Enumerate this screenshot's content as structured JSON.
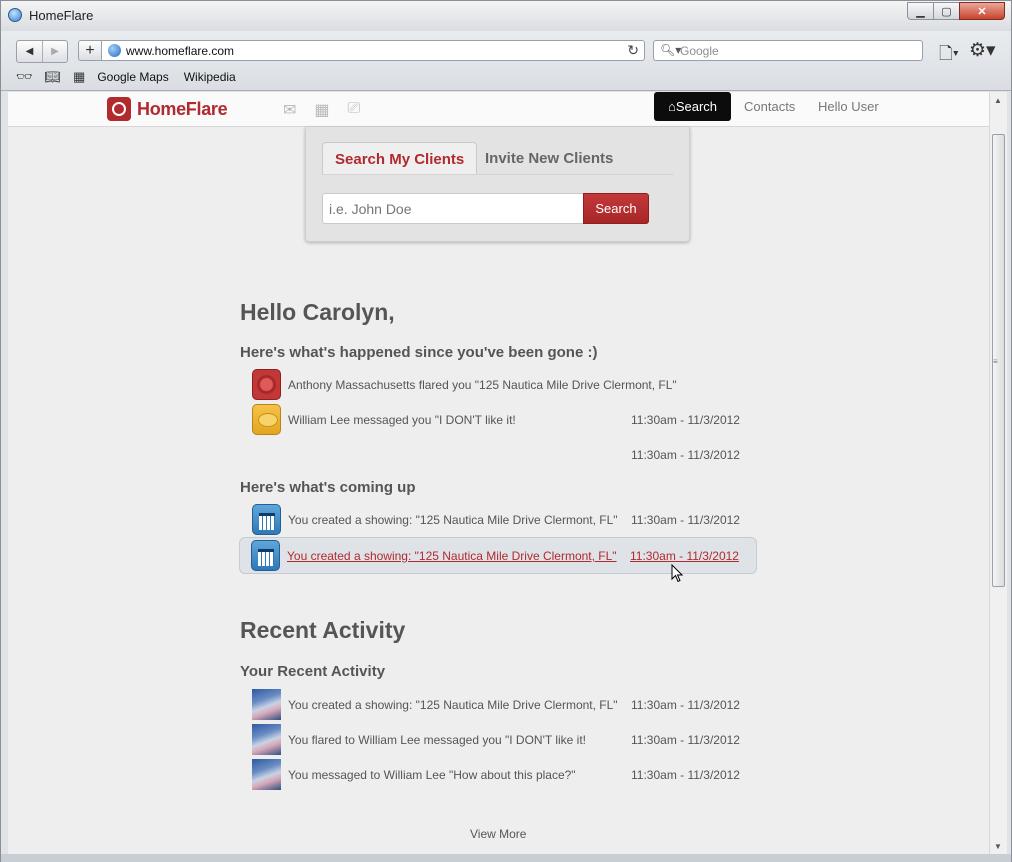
{
  "window": {
    "title": "HomeFlare"
  },
  "browser": {
    "url": "www.homeflare.com",
    "search_placeholder": "Google",
    "bookmarks": [
      "Google Maps",
      "Wikipedia"
    ]
  },
  "site": {
    "logo": "HomeFlare",
    "nav": {
      "search": "Search",
      "contacts": "Contacts",
      "user": "Hello User"
    }
  },
  "search_panel": {
    "tabs": [
      "Search My Clients",
      "Invite New Clients"
    ],
    "placeholder": "i.e. John Doe",
    "button": "Search"
  },
  "greeting": "Hello Carolyn,",
  "since_gone": {
    "heading": "Here's what's happened since you've been gone :)",
    "items": [
      {
        "icon": "flare-icon",
        "text": "Anthony Massachusetts flared you \"125 Nautica Mile Drive Clermont, FL\"",
        "time": ""
      },
      {
        "icon": "message-icon",
        "text": "William Lee messaged you \"I DON'T like it!",
        "time": "11:30am - 11/3/2012"
      },
      {
        "icon": "",
        "text": "",
        "time": "11:30am - 11/3/2012"
      }
    ]
  },
  "coming_up": {
    "heading": "Here's what's coming up",
    "items": [
      {
        "icon": "calendar-icon",
        "text": "You created a showing: \"125 Nautica Mile Drive Clermont, FL\"",
        "time": "11:30am - 11/3/2012"
      },
      {
        "icon": "calendar-icon",
        "text": "You created a showing: \"125 Nautica Mile Drive Clermont, FL\"",
        "time": "11:30am - 11/3/2012"
      }
    ]
  },
  "recent": {
    "heading": "Recent Activity",
    "subheading": "Your Recent Activity",
    "items": [
      {
        "text": "You created a showing: \"125 Nautica Mile Drive Clermont, FL\"",
        "time": "11:30am - 11/3/2012"
      },
      {
        "text": "You flared to William Lee messaged you \"I DON'T like it!",
        "time": "11:30am - 11/3/2012"
      },
      {
        "text": "You messaged to William Lee \"How about this place?\"",
        "time": "11:30am - 11/3/2012"
      }
    ],
    "view_more": "View More"
  }
}
